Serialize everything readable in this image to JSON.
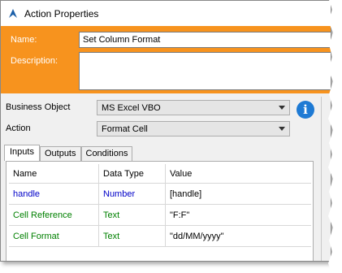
{
  "window": {
    "title": "Action Properties"
  },
  "header": {
    "name_label": "Name:",
    "name_value": "Set Column Format",
    "description_label": "Description:",
    "description_value": ""
  },
  "business_object": {
    "label": "Business Object",
    "value": "MS Excel VBO"
  },
  "action": {
    "label": "Action",
    "value": "Format Cell"
  },
  "info_icon_glyph": "i",
  "tabs": [
    {
      "label": "Inputs",
      "active": true
    },
    {
      "label": "Outputs",
      "active": false
    },
    {
      "label": "Conditions",
      "active": false
    }
  ],
  "table": {
    "columns": [
      "Name",
      "Data Type",
      "Value"
    ],
    "rows": [
      {
        "name": "handle",
        "type": "Number",
        "value": "[handle]",
        "color": "#0000c8"
      },
      {
        "name": "Cell Reference",
        "type": "Text",
        "value": "\"F:F\"",
        "color": "#008000"
      },
      {
        "name": "Cell Format",
        "type": "Text",
        "value": "\"dd/MM/yyyy\"",
        "color": "#008000"
      }
    ]
  },
  "colors": {
    "header_accent": "#f7931e",
    "info_icon": "#1e7ad4"
  }
}
